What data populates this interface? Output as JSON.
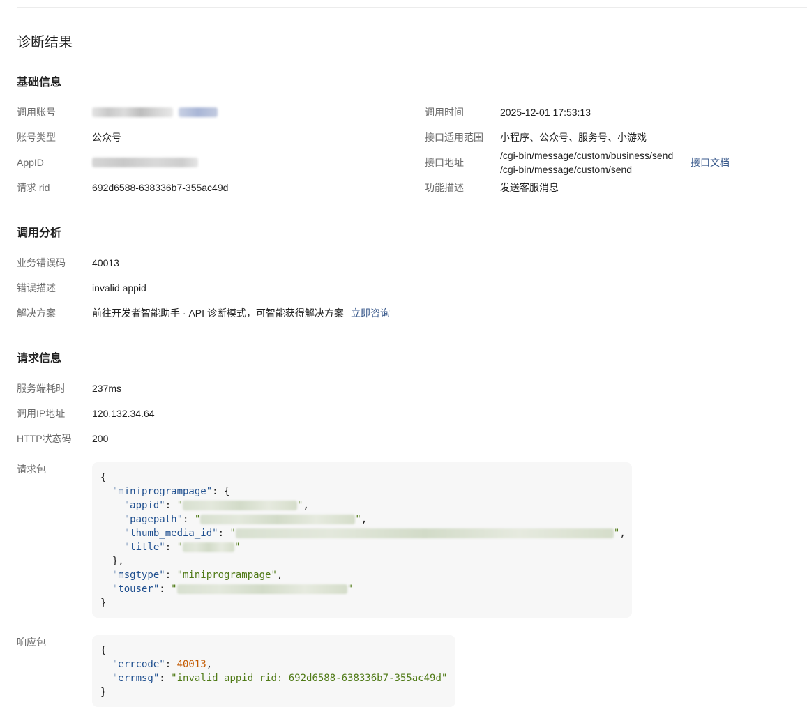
{
  "page_title": "诊断结果",
  "basic_info": {
    "section_title": "基础信息",
    "left": [
      {
        "label": "调用账号",
        "value": ""
      },
      {
        "label": "账号类型",
        "value": "公众号"
      },
      {
        "label": "AppID",
        "value": ""
      },
      {
        "label": "请求 rid",
        "value": "692d6588-638336b7-355ac49d"
      }
    ],
    "right": {
      "call_time_label": "调用时间",
      "call_time_value": "2025-12-01 17:53:13",
      "scope_label": "接口适用范围",
      "scope_value": "小程序、公众号、服务号、小游戏",
      "address_label": "接口地址",
      "address_line1": "/cgi-bin/message/custom/business/send",
      "address_line2": "/cgi-bin/message/custom/send",
      "doc_link": "接口文档",
      "desc_label": "功能描述",
      "desc_value": "发送客服消息"
    }
  },
  "call_analysis": {
    "section_title": "调用分析",
    "error_code_label": "业务错误码",
    "error_code_value": "40013",
    "error_desc_label": "错误描述",
    "error_desc_value": "invalid appid",
    "solution_label": "解决方案",
    "solution_value": "前往开发者智能助手 · API 诊断模式，可智能获得解决方案",
    "solution_link": "立即咨询"
  },
  "request_info": {
    "section_title": "请求信息",
    "server_time_label": "服务端耗时",
    "server_time_value": "237ms",
    "ip_label": "调用IP地址",
    "ip_value": "120.132.34.64",
    "http_label": "HTTP状态码",
    "http_value": "200",
    "request_label": "请求包",
    "request_json": {
      "open_brace": "{",
      "key_miniprogrampage": "\"miniprogrampage\"",
      "key_appid": "\"appid\"",
      "key_pagepath": "\"pagepath\"",
      "key_thumb_media_id": "\"thumb_media_id\"",
      "key_title": "\"title\"",
      "key_msgtype": "\"msgtype\"",
      "val_msgtype": "\"miniprogrampage\"",
      "key_touser": "\"touser\"",
      "close_brace": "}"
    },
    "response_label": "响应包",
    "response_json": {
      "key_errcode": "\"errcode\"",
      "val_errcode": "40013",
      "key_errmsg": "\"errmsg\"",
      "val_errmsg": "\"invalid appid rid: 692d6588-638336b7-355ac49d\""
    }
  }
}
